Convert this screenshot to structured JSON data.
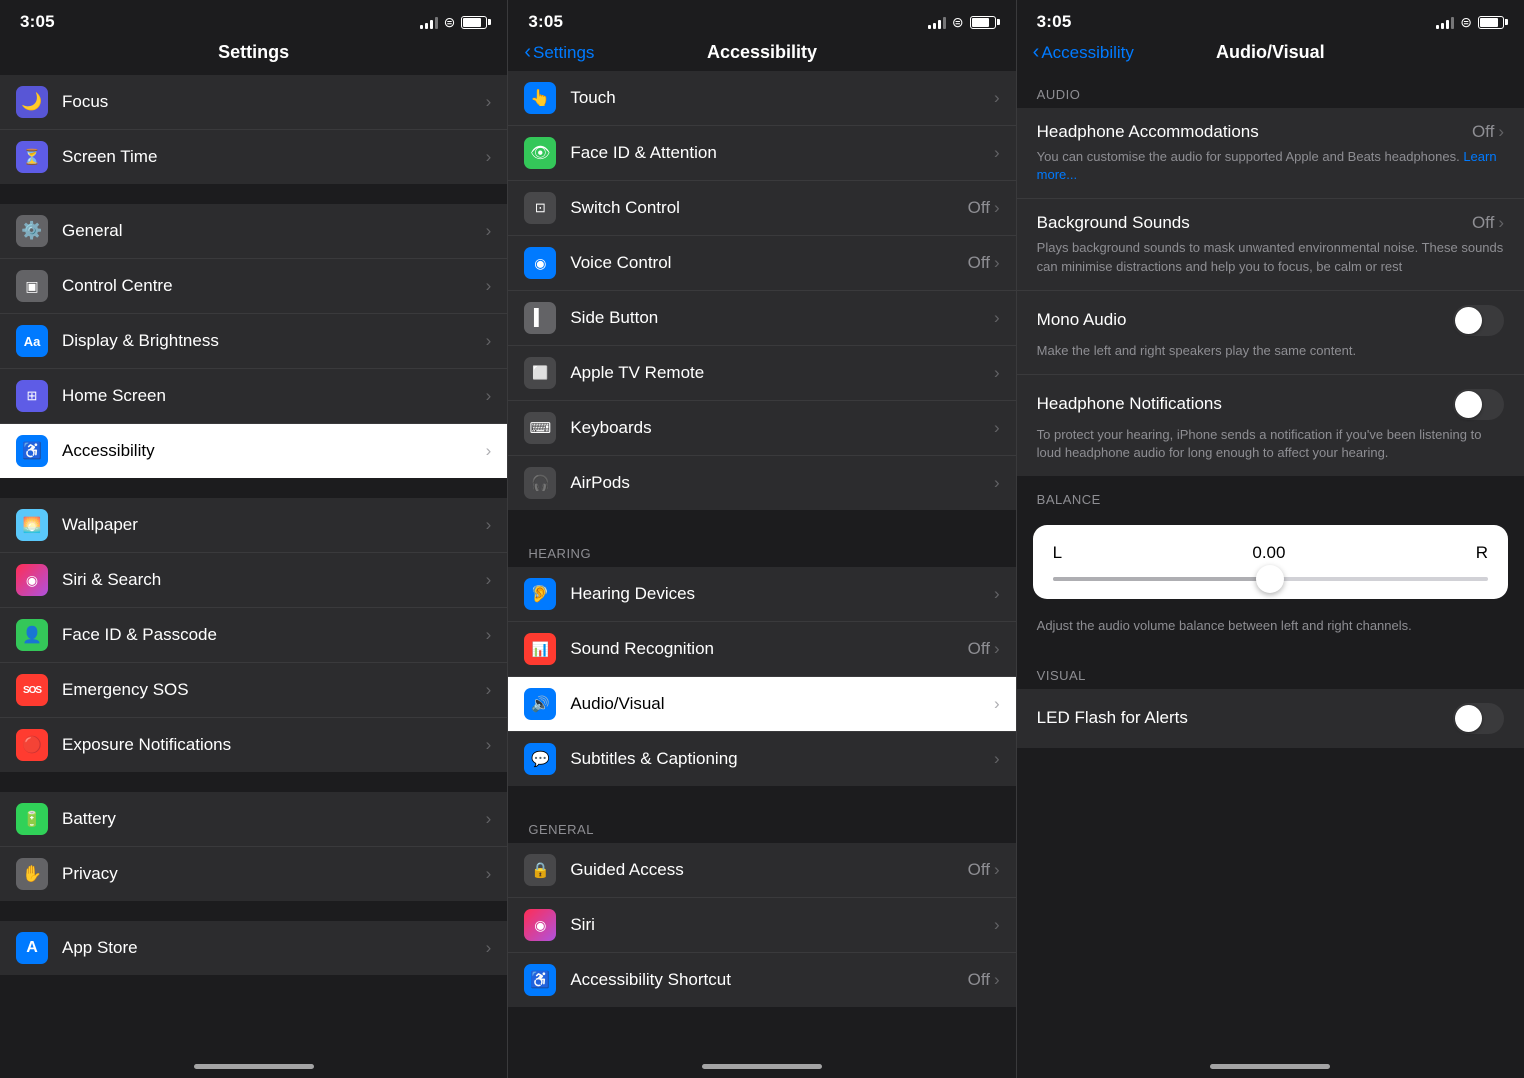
{
  "panel1": {
    "status": {
      "time": "3:05"
    },
    "nav": {
      "title": "Settings"
    },
    "groups": [
      {
        "items": [
          {
            "id": "focus",
            "icon": "🌙",
            "iconClass": "ic-purple",
            "title": "Focus",
            "value": "",
            "chevron": "›"
          },
          {
            "id": "screen-time",
            "icon": "⏱",
            "iconClass": "ic-indigo",
            "title": "Screen Time",
            "value": "",
            "chevron": "›"
          }
        ]
      },
      {
        "items": [
          {
            "id": "general",
            "icon": "⚙️",
            "iconClass": "ic-gray",
            "title": "General",
            "value": "",
            "chevron": "›"
          },
          {
            "id": "control-centre",
            "icon": "▣",
            "iconClass": "ic-gray",
            "title": "Control Centre",
            "value": "",
            "chevron": "›"
          },
          {
            "id": "display-brightness",
            "icon": "Aa",
            "iconClass": "ic-blue",
            "title": "Display & Brightness",
            "value": "",
            "chevron": "›"
          },
          {
            "id": "home-screen",
            "icon": "⊞",
            "iconClass": "ic-indigo",
            "title": "Home Screen",
            "value": "",
            "chevron": "›"
          },
          {
            "id": "accessibility",
            "icon": "♿",
            "iconClass": "ic-blue",
            "title": "Accessibility",
            "value": "",
            "chevron": "›",
            "selected": true
          }
        ]
      },
      {
        "items": [
          {
            "id": "wallpaper",
            "icon": "🌅",
            "iconClass": "ic-teal",
            "title": "Wallpaper",
            "value": "",
            "chevron": "›"
          },
          {
            "id": "siri-search",
            "icon": "◉",
            "iconClass": "ic-pink",
            "title": "Siri & Search",
            "value": "",
            "chevron": "›"
          },
          {
            "id": "face-id",
            "icon": "👤",
            "iconClass": "ic-green",
            "title": "Face ID & Passcode",
            "value": "",
            "chevron": "›"
          },
          {
            "id": "emergency-sos",
            "icon": "SOS",
            "iconClass": "ic-sos",
            "title": "Emergency SOS",
            "value": "",
            "chevron": "›"
          },
          {
            "id": "exposure",
            "icon": "🔴",
            "iconClass": "ic-exposure",
            "title": "Exposure Notifications",
            "value": "",
            "chevron": "›"
          }
        ]
      },
      {
        "items": [
          {
            "id": "battery",
            "icon": "🔋",
            "iconClass": "ic-battery",
            "title": "Battery",
            "value": "",
            "chevron": "›"
          },
          {
            "id": "privacy",
            "icon": "✋",
            "iconClass": "ic-privacy",
            "title": "Privacy",
            "value": "",
            "chevron": "›"
          }
        ]
      },
      {
        "items": [
          {
            "id": "app-store",
            "icon": "A",
            "iconClass": "ic-appstore",
            "title": "App Store",
            "value": "",
            "chevron": "›"
          }
        ]
      }
    ]
  },
  "panel2": {
    "status": {
      "time": "3:05"
    },
    "nav": {
      "title": "Accessibility",
      "back": "Settings"
    },
    "sections": [
      {
        "label": "",
        "items": [
          {
            "id": "touch",
            "icon": "👆",
            "iconClass": "ic-blue",
            "title": "Touch",
            "value": "",
            "chevron": "›"
          },
          {
            "id": "face-id-attention",
            "icon": "👁",
            "iconClass": "ic-green",
            "title": "Face ID & Attention",
            "value": "",
            "chevron": "›"
          },
          {
            "id": "switch-control",
            "icon": "⊡",
            "iconClass": "ic-dark-gray",
            "title": "Switch Control",
            "value": "Off",
            "chevron": "›"
          },
          {
            "id": "voice-control",
            "icon": "◉",
            "iconClass": "ic-blue",
            "title": "Voice Control",
            "value": "Off",
            "chevron": "›"
          },
          {
            "id": "side-button",
            "icon": "▍",
            "iconClass": "ic-gray",
            "title": "Side Button",
            "value": "",
            "chevron": "›"
          },
          {
            "id": "apple-tv-remote",
            "icon": "⬜",
            "iconClass": "ic-dark-gray",
            "title": "Apple TV Remote",
            "value": "",
            "chevron": "›"
          },
          {
            "id": "keyboards",
            "icon": "⌨",
            "iconClass": "ic-dark-gray",
            "title": "Keyboards",
            "value": "",
            "chevron": "›"
          },
          {
            "id": "airpods",
            "icon": "🎧",
            "iconClass": "ic-dark-gray",
            "title": "AirPods",
            "value": "",
            "chevron": "›"
          }
        ]
      },
      {
        "label": "HEARING",
        "items": [
          {
            "id": "hearing-devices",
            "icon": "🦻",
            "iconClass": "ic-blue",
            "title": "Hearing Devices",
            "value": "",
            "chevron": "›"
          },
          {
            "id": "sound-recognition",
            "icon": "📊",
            "iconClass": "ic-red",
            "title": "Sound Recognition",
            "value": "Off",
            "chevron": "›"
          },
          {
            "id": "audio-visual",
            "icon": "🔊",
            "iconClass": "ic-blue",
            "title": "Audio/Visual",
            "value": "",
            "chevron": "›",
            "selected": true
          },
          {
            "id": "subtitles-captioning",
            "icon": "💬",
            "iconClass": "ic-blue",
            "title": "Subtitles & Captioning",
            "value": "",
            "chevron": "›"
          }
        ]
      },
      {
        "label": "GENERAL",
        "items": [
          {
            "id": "guided-access",
            "icon": "🔒",
            "iconClass": "ic-dark-gray",
            "title": "Guided Access",
            "value": "Off",
            "chevron": "›"
          },
          {
            "id": "siri",
            "icon": "◉",
            "iconClass": "ic-pink",
            "title": "Siri",
            "value": "",
            "chevron": "›"
          },
          {
            "id": "accessibility-shortcut",
            "icon": "♿",
            "iconClass": "ic-blue",
            "title": "Accessibility Shortcut",
            "value": "Off",
            "chevron": "›"
          }
        ]
      }
    ]
  },
  "panel3": {
    "status": {
      "time": "3:05"
    },
    "nav": {
      "title": "Audio/Visual",
      "back": "Accessibility"
    },
    "sections": [
      {
        "label": "AUDIO",
        "items": [
          {
            "id": "headphone-accommodations",
            "title": "Headphone Accommodations",
            "value": "Off",
            "chevron": "›",
            "desc": "You can customise the audio for supported Apple and Beats headphones.",
            "learnMore": "Learn more..."
          },
          {
            "id": "background-sounds",
            "title": "Background Sounds",
            "value": "Off",
            "chevron": "›",
            "desc": "Plays background sounds to mask unwanted environmental noise. These sounds can minimise distractions and help you to focus, be calm or rest"
          },
          {
            "id": "mono-audio",
            "title": "Mono Audio",
            "toggle": true,
            "toggleOn": false,
            "desc": "Make the left and right speakers play the same content."
          },
          {
            "id": "headphone-notifications",
            "title": "Headphone Notifications",
            "toggle": true,
            "toggleOn": false,
            "desc": "To protect your hearing, iPhone sends a notification if you've been listening to loud headphone audio for long enough to affect your hearing."
          }
        ]
      },
      {
        "label": "BALANCE",
        "balance": {
          "left": "L",
          "right": "R",
          "value": "0.00",
          "desc": "Adjust the audio volume balance between left and right channels."
        }
      },
      {
        "label": "VISUAL",
        "items": [
          {
            "id": "led-flash-alerts",
            "title": "LED Flash for Alerts",
            "toggle": true,
            "toggleOn": false
          }
        ]
      }
    ]
  }
}
